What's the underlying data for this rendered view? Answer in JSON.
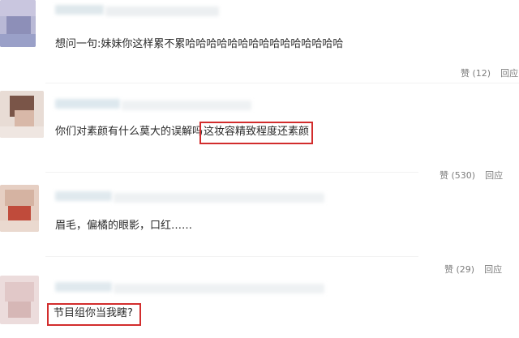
{
  "colors": {
    "highlight": "#d22d2d",
    "meta_text": "#7d7d7d",
    "body_text": "#2b2b2b"
  },
  "comments": [
    {
      "text": "想问一句:妹妹你这样累不累哈哈哈哈哈哈哈哈哈哈哈哈哈哈哈",
      "like_label": "赞 (12)",
      "reply_label": "回应"
    },
    {
      "text_before": "你们对素颜有什么莫大的误解吗",
      "text_highlight": "这妆容精致程度还素颜",
      "like_label": "赞 (530)",
      "reply_label": "回应"
    },
    {
      "text": "眉毛，偏橘的眼影，口红……",
      "like_label": "赞 (29)",
      "reply_label": "回应"
    },
    {
      "text_highlight": "节目组你当我瞎?"
    }
  ]
}
